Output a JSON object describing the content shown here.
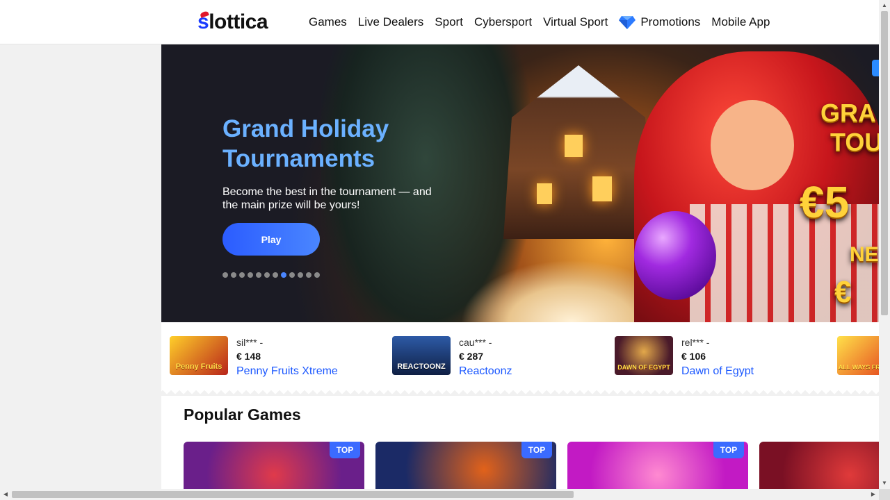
{
  "brand": {
    "logo_s": "s",
    "logo_rest": "lottica"
  },
  "nav": {
    "items": [
      {
        "label": "Games"
      },
      {
        "label": "Live Dealers"
      },
      {
        "label": "Sport"
      },
      {
        "label": "Cybersport"
      },
      {
        "label": "Virtual Sport"
      },
      {
        "label": "Promotions",
        "icon": "diamond-icon"
      },
      {
        "label": "Mobile App"
      }
    ]
  },
  "banner": {
    "title": "Grand Holiday Tournaments",
    "subtitle": "Become the best in the tournament — and the main prize will be yours!",
    "button": "Play",
    "dots_total": 12,
    "dots_active": 7,
    "art_text": {
      "line1": "GRA",
      "line2": "TOU",
      "prize": "€5",
      "ne": "NE",
      "euro": "€"
    }
  },
  "winners": [
    {
      "user": "sil*** -",
      "amount": "€ 148",
      "game": "Penny Fruits Xtreme",
      "thumb_text": "Penny Fruits",
      "color": "#b8241a"
    },
    {
      "user": "cau*** -",
      "amount": "€ 287",
      "game": "Reactoonz",
      "thumb_text": "REACTOONZ",
      "color": "#1c3a6b"
    },
    {
      "user": "rel*** -",
      "amount": "€ 106",
      "game": "Dawn of Egypt",
      "thumb_text": "DAWN OF EGYPT",
      "color": "#4a1a2a"
    },
    {
      "user": "",
      "amount": "",
      "game": "",
      "thumb_text": "ALL WAYS FRUITS",
      "color": "#e2a62a"
    }
  ],
  "popular": {
    "title": "Popular Games",
    "cards": [
      {
        "badge": "TOP",
        "color_a": "#6a1f8a",
        "color_b": "#e03a4a"
      },
      {
        "badge": "TOP",
        "color_a": "#1b2a66",
        "color_b": "#e2621a"
      },
      {
        "badge": "TOP",
        "color_a": "#c21ac4",
        "color_b": "#ff8ad1"
      },
      {
        "badge": "",
        "color_a": "#7a1024",
        "color_b": "#e03a3a"
      }
    ]
  },
  "colors": {
    "accent": "#1a57ff",
    "title_blue": "#6bb1ff",
    "brand_red": "#e0162b"
  }
}
